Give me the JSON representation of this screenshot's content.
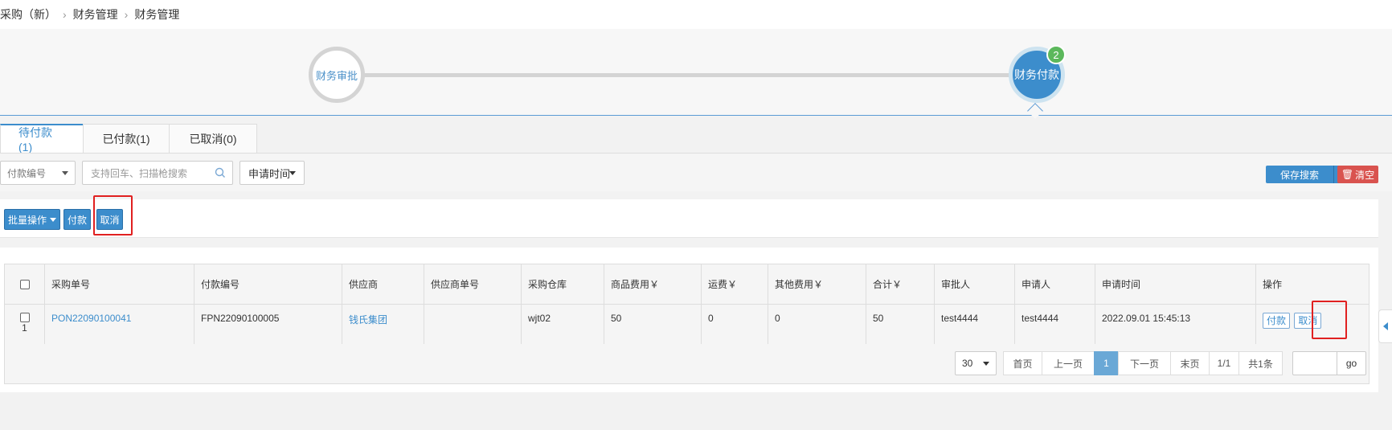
{
  "breadcrumb": [
    "采购（新）",
    "财务管理",
    "财务管理"
  ],
  "steps": {
    "step1": "财务审批",
    "step2": "财务付款",
    "step2_badge": "2"
  },
  "tabs": [
    "待付款(1)",
    "已付款(1)",
    "已取消(0)"
  ],
  "filter": {
    "select_label": "付款编号",
    "search_placeholder": "支持回车、扫描枪搜索",
    "date_label": "申请时间",
    "save_search": "保存搜索",
    "clear": "清空"
  },
  "actions": {
    "batch": "批量操作",
    "pay": "付款",
    "cancel": "取消"
  },
  "table": {
    "headers": [
      "采购单号",
      "付款编号",
      "供应商",
      "供应商单号",
      "采购仓库",
      "商品费用￥",
      "运费￥",
      "其他费用￥",
      "合计￥",
      "审批人",
      "申请人",
      "申请时间",
      "操作"
    ],
    "rows": [
      {
        "index": "1",
        "po_no": "PON22090100041",
        "payment_no": "FPN22090100005",
        "supplier": "钱氏集团",
        "supplier_no": "",
        "warehouse": "wjt02",
        "goods_fee": "50",
        "freight": "0",
        "other_fee": "0",
        "total": "50",
        "approver": "test4444",
        "applicant": "test4444",
        "apply_time": "2022.09.01 15:45:13",
        "op_pay": "付款",
        "op_cancel": "取消"
      }
    ]
  },
  "pager": {
    "page_size": "30",
    "first": "首页",
    "prev": "上一页",
    "current": "1",
    "next": "下一页",
    "last": "末页",
    "page_info": "1/1",
    "total": "共1条",
    "go": "go"
  },
  "colors": {
    "primary": "#3c8dcc",
    "danger": "#d9534f",
    "success": "#5cb85c",
    "highlight": "#e02020"
  }
}
